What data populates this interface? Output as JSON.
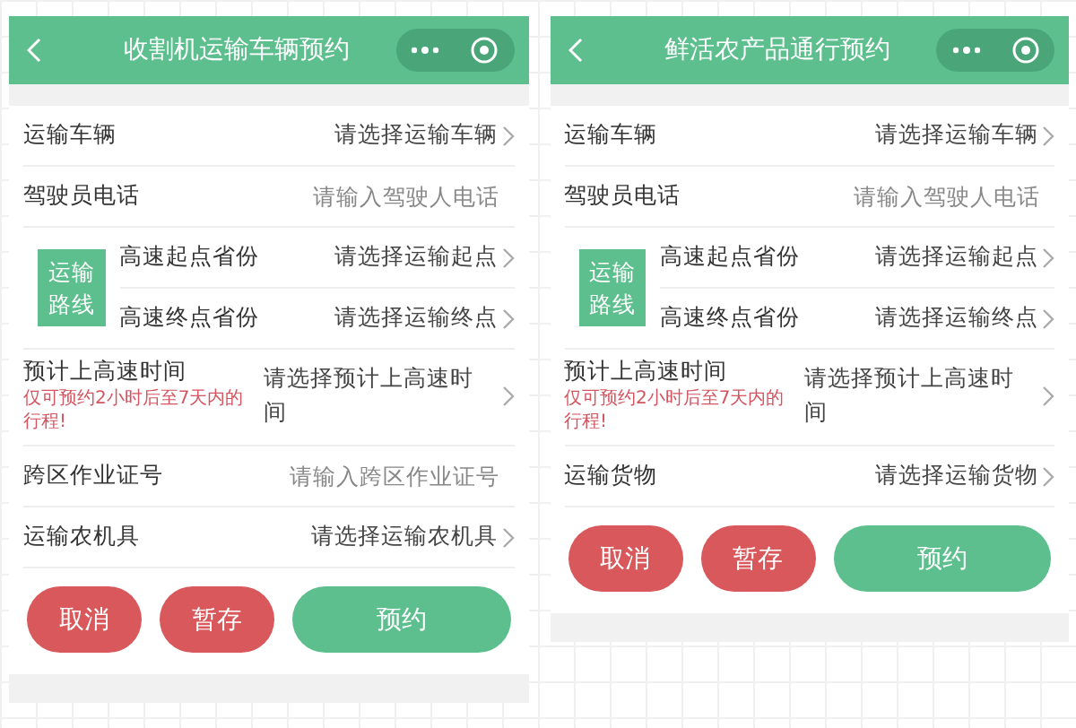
{
  "screens": [
    {
      "title": "收割机运输车辆预约",
      "fields": [
        {
          "kind": "select",
          "label": "运输车辆",
          "value": "请选择运输车辆"
        },
        {
          "kind": "input",
          "label": "驾驶员电话",
          "placeholder": "请输入驾驶人电话"
        },
        {
          "kind": "route",
          "badge": "运输路线",
          "rows": [
            {
              "label": "高速起点省份",
              "value": "请选择运输起点"
            },
            {
              "label": "高速终点省份",
              "value": "请选择运输终点"
            }
          ]
        },
        {
          "kind": "select",
          "label": "预计上高速时间",
          "note": "仅可预约2小时后至7天内的行程!",
          "value": "请选择预计上高速时间"
        },
        {
          "kind": "input",
          "label": "跨区作业证号",
          "placeholder": "请输入跨区作业证号"
        },
        {
          "kind": "select",
          "label": "运输农机具",
          "value": "请选择运输农机具"
        }
      ],
      "buttons": [
        {
          "label": "取消",
          "kind": "cancel"
        },
        {
          "label": "暂存",
          "kind": "save"
        },
        {
          "label": "预约",
          "kind": "submit"
        }
      ]
    },
    {
      "title": "鲜活农产品通行预约",
      "fields": [
        {
          "kind": "select",
          "label": "运输车辆",
          "value": "请选择运输车辆"
        },
        {
          "kind": "input",
          "label": "驾驶员电话",
          "placeholder": "请输入驾驶人电话"
        },
        {
          "kind": "route",
          "badge": "运输路线",
          "rows": [
            {
              "label": "高速起点省份",
              "value": "请选择运输起点"
            },
            {
              "label": "高速终点省份",
              "value": "请选择运输终点"
            }
          ]
        },
        {
          "kind": "select",
          "label": "预计上高速时间",
          "note": "仅可预约2小时后至7天内的行程!",
          "value": "请选择预计上高速时间"
        },
        {
          "kind": "select",
          "label": "运输货物",
          "value": "请选择运输货物"
        }
      ],
      "buttons": [
        {
          "label": "取消",
          "kind": "cancel"
        },
        {
          "label": "暂存",
          "kind": "save"
        },
        {
          "label": "预约",
          "kind": "submit"
        }
      ]
    }
  ]
}
